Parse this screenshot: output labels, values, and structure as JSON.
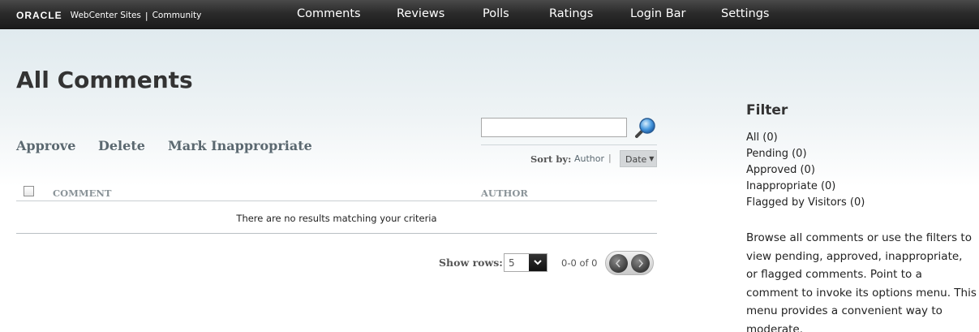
{
  "brand": {
    "oracle": "ORACLE",
    "product": "WebCenter Sites",
    "separator": "|",
    "section": "Community"
  },
  "nav": {
    "items": [
      "Comments",
      "Reviews",
      "Polls",
      "Ratings",
      "Login Bar",
      "Settings"
    ]
  },
  "page": {
    "title": "All Comments"
  },
  "actions": {
    "approve": "Approve",
    "delete": "Delete",
    "mark_inappropriate": "Mark Inappropriate"
  },
  "search": {
    "value": "",
    "placeholder": ""
  },
  "sort": {
    "label": "Sort by:",
    "author": "Author",
    "separator": "|",
    "date": "Date",
    "active": "Date"
  },
  "table": {
    "columns": [
      "COMMENT",
      "AUTHOR"
    ],
    "empty_message": "There are no results matching your criteria"
  },
  "pager": {
    "show_rows_label": "Show rows:",
    "rows_value": "5",
    "range": "0-0 of 0"
  },
  "filter": {
    "title": "Filter",
    "items": [
      "All (0)",
      "Pending (0)",
      "Approved (0)",
      "Inappropriate (0)",
      "Flagged by Visitors (0)"
    ],
    "help": "Browse all comments or use the filters to view pending, approved, inappropriate, or flagged comments. Point to a comment to invoke its options menu. This menu provides a convenient way to moderate."
  },
  "colors": {
    "topbar": "#2b2b2b",
    "action_text": "#5a6870",
    "column_header": "#8a9398"
  },
  "icons": {
    "search": "magnifier-icon",
    "prev": "chevron-left-icon",
    "next": "chevron-right-icon",
    "dropdown": "chevron-down-icon"
  }
}
